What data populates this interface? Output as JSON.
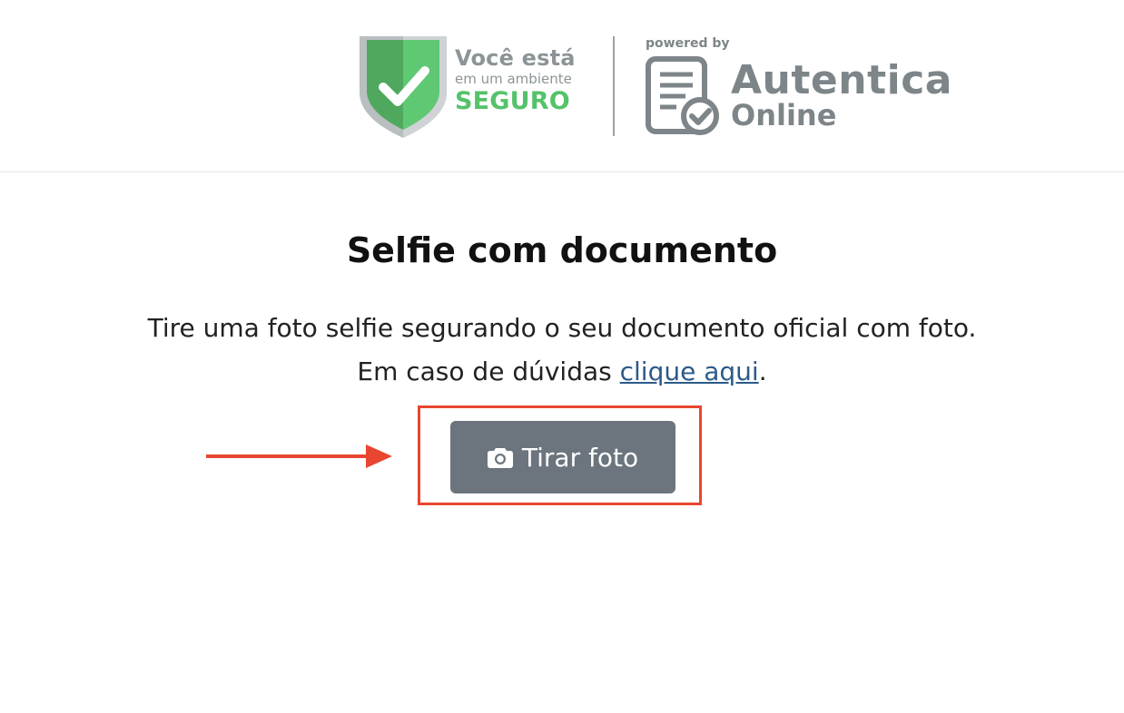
{
  "header": {
    "badge": {
      "line1": "Você está",
      "line2": "em um ambiente",
      "line3": "SEGURO"
    },
    "powered_by": "powered by",
    "brand_line1": "Autentica",
    "brand_line2": "Online"
  },
  "main": {
    "title": "Selfie com documento",
    "instruction": "Tire uma foto selfie segurando o seu documento oficial com foto.",
    "help_prefix": "Em caso de dúvidas ",
    "help_link": "clique aqui",
    "help_suffix": ".",
    "button_label": "Tirar foto"
  },
  "colors": {
    "shield_green": "#55c26a",
    "brand_gray": "#7d8589",
    "button_gray": "#6c757d",
    "highlight_red": "#e84630",
    "link_blue": "#2c5a8a"
  },
  "icons": [
    "shield-check-icon",
    "document-check-icon",
    "camera-icon",
    "arrow-right-icon"
  ]
}
